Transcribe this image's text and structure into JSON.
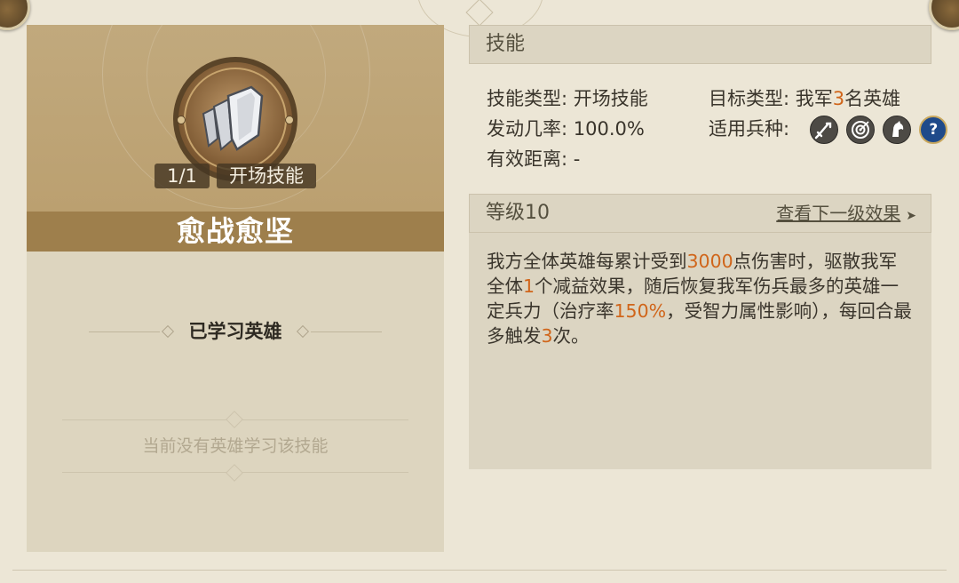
{
  "skill": {
    "name": "愈战愈坚",
    "level_badge": "1/1",
    "type_badge": "开场技能",
    "learned_heroes_title": "已学习英雄",
    "no_heroes_text": "当前没有英雄学习该技能"
  },
  "skill_section": {
    "title": "技能",
    "type_label": "技能类型:",
    "type_value": "开场技能",
    "target_label": "目标类型:",
    "target_prefix": "我军",
    "target_count": "3",
    "target_suffix": "名英雄",
    "rate_label": "发动几率:",
    "rate_value": "100.0%",
    "unit_label": "适用兵种:",
    "range_label": "有效距离:",
    "range_value": "-",
    "unit_icons": [
      "sword-unit-icon",
      "archer-target-unit-icon",
      "cavalry-horse-unit-icon",
      "unknown-question-unit-icon"
    ],
    "unit_question": "?"
  },
  "level_section": {
    "title": "等级10",
    "next_link": "查看下一级效果",
    "desc_1": "我方全体英雄每累计受到",
    "desc_2": "3000",
    "desc_3": "点伤害时，驱散我军全体",
    "desc_4": "1",
    "desc_5": "个减益效果，随后恢复我军伤兵最多的英雄一定兵力（治疗率",
    "desc_6": "150%",
    "desc_7": "，受智力属性影响），每回合最多触发",
    "desc_8": "3",
    "desc_9": "次。"
  },
  "colors": {
    "highlight": "#d0651a",
    "name_bar": "#9e7f4c",
    "panel_bg": "#dcd5c2"
  }
}
